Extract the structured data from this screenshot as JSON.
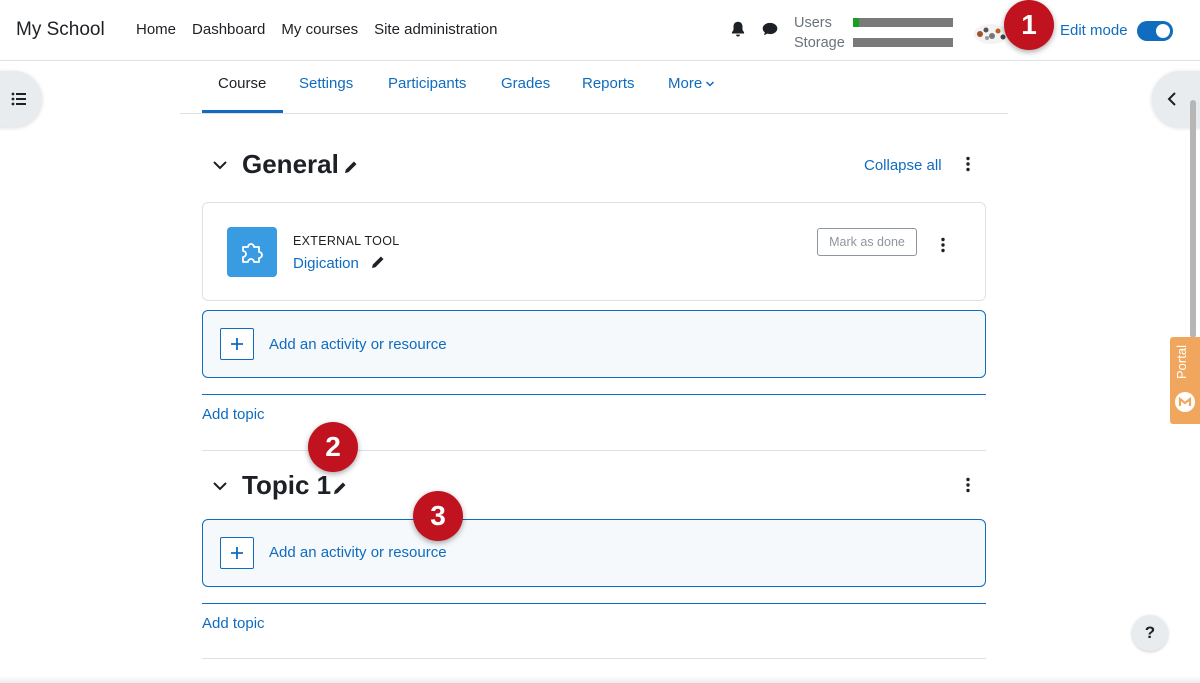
{
  "navbar": {
    "brand": "My School",
    "links": [
      "Home",
      "Dashboard",
      "My courses",
      "Site administration"
    ],
    "quota_users_label": "Users",
    "quota_storage_label": "Storage",
    "quota_users_fraction": 0.06,
    "quota_storage_fraction": 0.0,
    "edit_mode_label": "Edit mode",
    "edit_mode_on": true
  },
  "secondary_nav": {
    "tabs": [
      "Course",
      "Settings",
      "Participants",
      "Grades",
      "Reports",
      "More"
    ],
    "active_tab": "Course"
  },
  "general_section": {
    "title": "General",
    "collapse_all": "Collapse all",
    "activity": {
      "type": "EXTERNAL TOOL",
      "name": "Digication",
      "completion_button": "Mark as done"
    },
    "add_activity": "Add an activity or resource",
    "add_topic": "Add topic"
  },
  "topic_section": {
    "title": "Topic 1",
    "add_activity": "Add an activity or resource",
    "add_topic": "Add topic"
  },
  "callouts": [
    "1",
    "2",
    "3"
  ],
  "portal_label": "Portal",
  "help_label": "?",
  "colors": {
    "link": "#0f6cbf",
    "callout": "#c1121f",
    "tool_icon": "#399be2",
    "portal": "#f0a75d"
  }
}
